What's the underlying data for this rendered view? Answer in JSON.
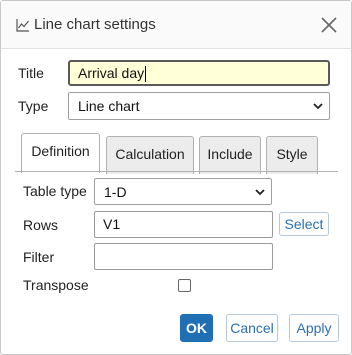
{
  "dialog": {
    "title": "Line chart settings",
    "icon": "line-chart-icon",
    "close_icon": "close-icon"
  },
  "form": {
    "title_label": "Title",
    "title_value": "Arrival day",
    "type_label": "Type",
    "type_value": "Line chart"
  },
  "tabs": [
    {
      "label": "Definition",
      "active": true
    },
    {
      "label": "Calculation",
      "active": false
    },
    {
      "label": "Include",
      "active": false
    },
    {
      "label": "Style",
      "active": false
    }
  ],
  "definition": {
    "table_type_label": "Table type",
    "table_type_value": "1-D",
    "rows_label": "Rows",
    "rows_value": "V1",
    "select_label": "Select",
    "filter_label": "Filter",
    "filter_value": "",
    "transpose_label": "Transpose",
    "transpose_checked": false
  },
  "buttons": {
    "ok": "OK",
    "cancel": "Cancel",
    "apply": "Apply"
  },
  "colors": {
    "primary": "#1f6fb5",
    "active_input_bg": "#ffffd8"
  }
}
